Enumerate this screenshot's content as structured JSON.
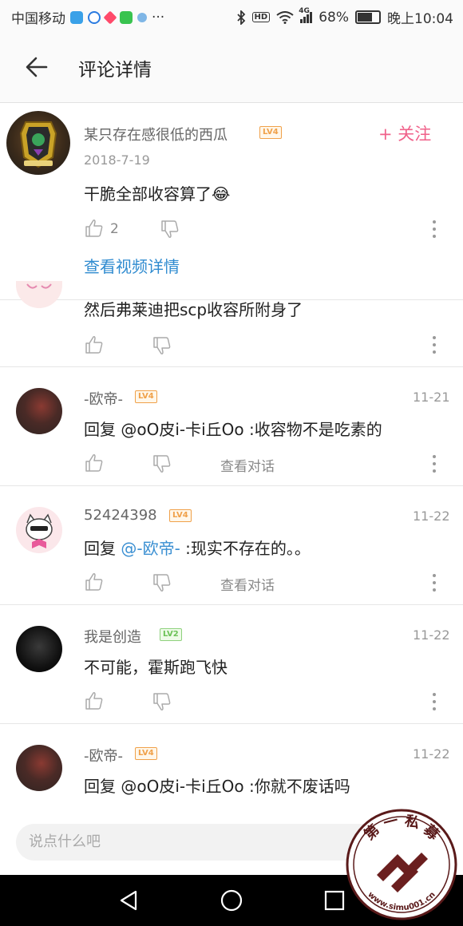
{
  "status_bar": {
    "carrier": "中国移动",
    "more": "···",
    "network": "4G",
    "battery": "68%",
    "time": "晚上10:04",
    "battery_level": 0.68
  },
  "app_bar": {
    "title": "评论详情"
  },
  "main_comment": {
    "username": "某只存在感很低的西瓜",
    "level": "LV4",
    "date": "2018-7-19",
    "text": "干脆全部收容算了",
    "emoji": "😂",
    "like_count": "2",
    "follow_label": "关注",
    "video_link": "查看视频详情"
  },
  "replies": [
    {
      "text": "然后弗莱迪把scp收容所附身了"
    },
    {
      "username": "-欧帝-",
      "level": "LV4",
      "date": "11-21",
      "prefix": "回复 @oO皮i-卡i丘Oo :收容物不是吃素的",
      "conv": "查看对话"
    },
    {
      "username": "52424398",
      "level": "LV4",
      "date": "11-22",
      "prefix": "回复 ",
      "mention": "@-欧帝-",
      "suffix": " :现实不存在的。。",
      "conv": "查看对话"
    },
    {
      "username": "我是创造",
      "level": "LV2",
      "date": "11-22",
      "text": "不可能，霍斯跑飞快"
    },
    {
      "username": "-欧帝-",
      "level": "LV4",
      "date": "11-22",
      "text": "回复 @oO皮i-卡i丘Oo :你就不废话吗"
    }
  ],
  "input": {
    "placeholder": "说点什么吧"
  },
  "watermark": {
    "top_text": "第 一 私 募",
    "bottom_text": "www.simu001.cn"
  },
  "colors": {
    "accent_pink": "#f0618a",
    "link_blue": "#2f8bd0",
    "level_orange": "#f0a14a",
    "level_green": "#6cc257"
  }
}
